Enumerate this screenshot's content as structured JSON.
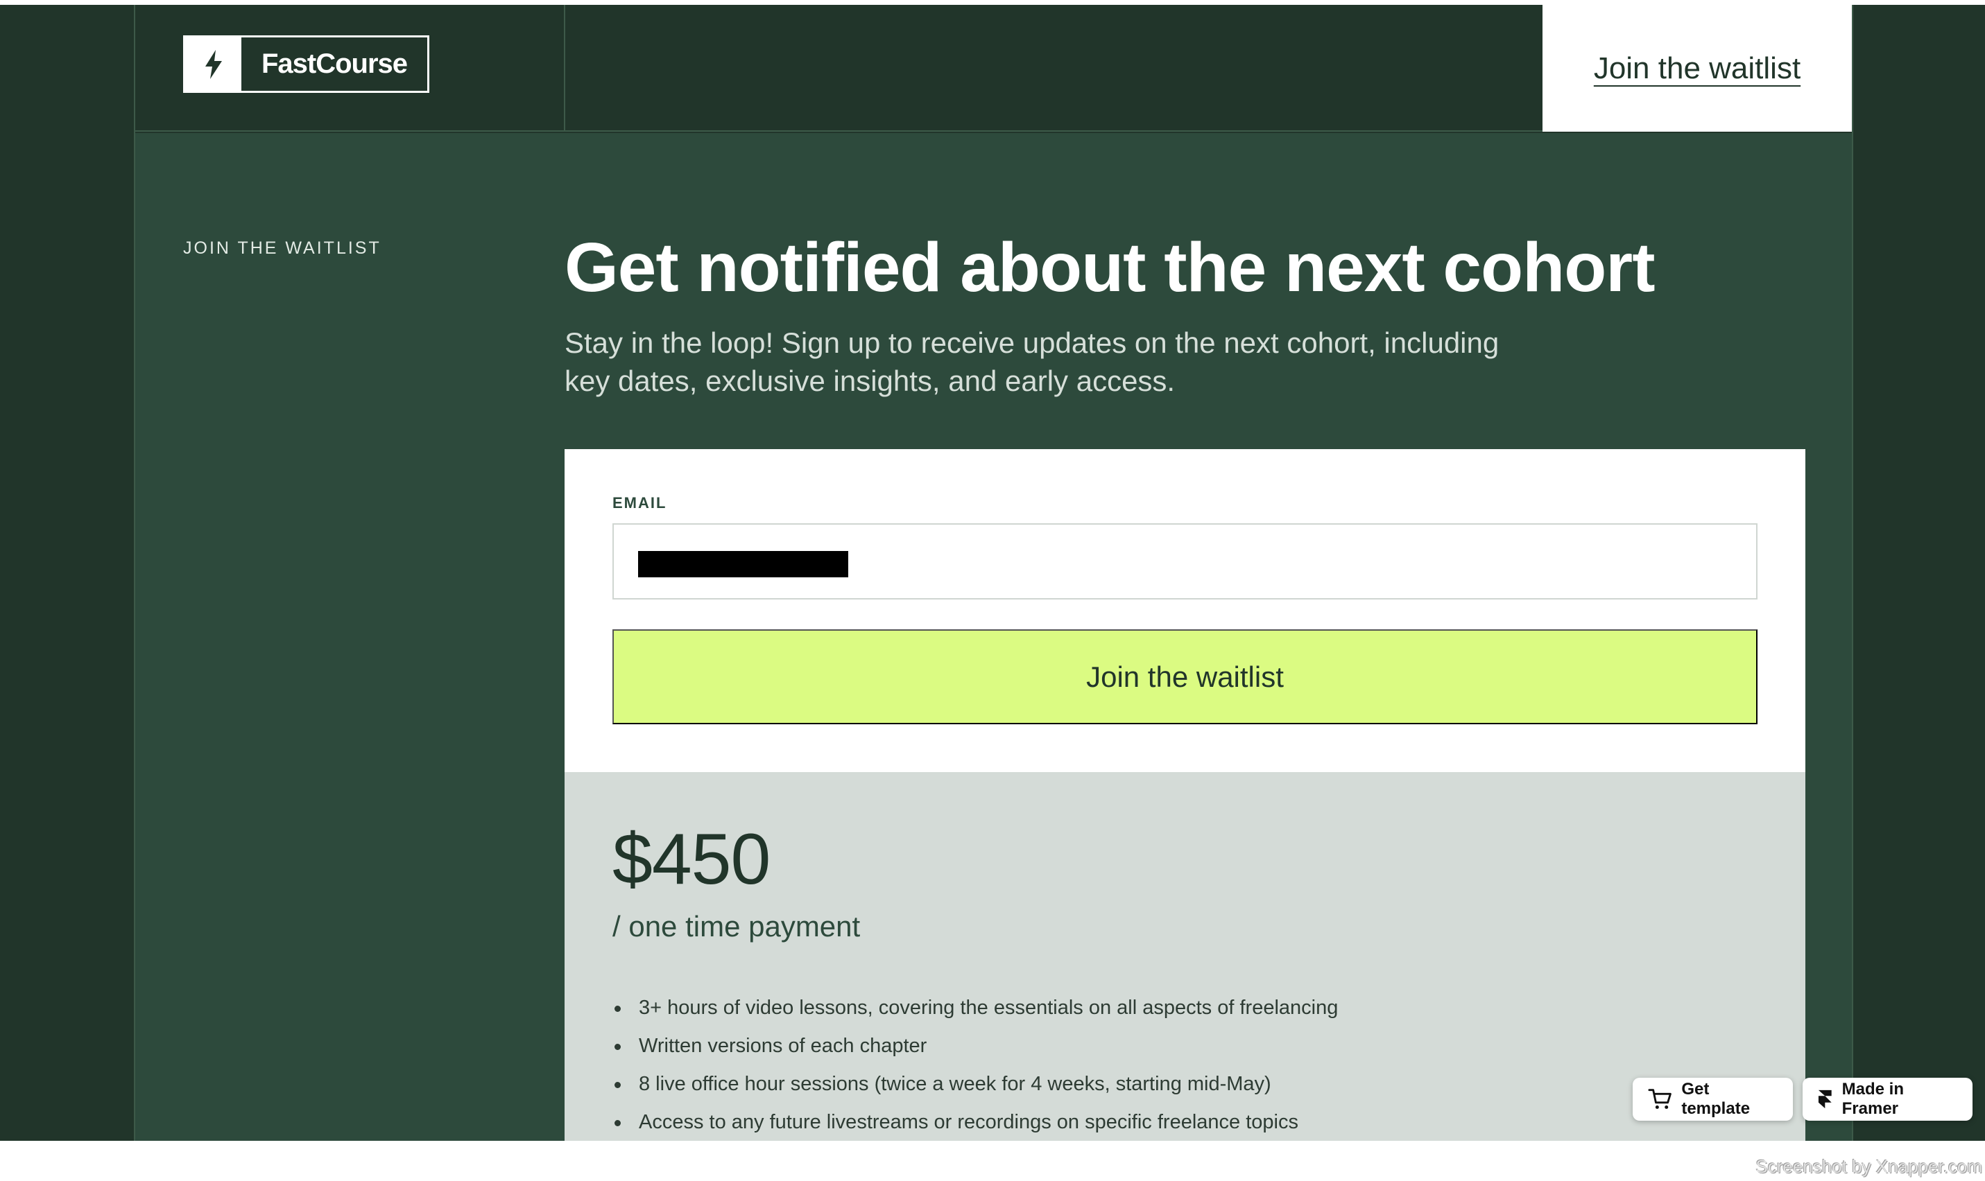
{
  "header": {
    "logo_text": "FastCourse",
    "nav_cta_label": "Join the waitlist"
  },
  "hero": {
    "eyebrow": "JOIN THE WAITLIST",
    "title": "Get notified about the next cohort",
    "subtitle": "Stay in the loop! Sign up to receive updates on the next cohort, including key dates, exclusive insights, and early access."
  },
  "form": {
    "email_label": "EMAIL",
    "submit_label": "Join the waitlist"
  },
  "pricing": {
    "price": "$450",
    "price_note": "/ one time payment",
    "features": [
      "3+ hours of video lessons, covering the essentials on all aspects of freelancing",
      "Written versions of each chapter",
      "8 live office hour sessions (twice a week for 4 weeks, starting mid-May)",
      "Access to any future livestreams or recordings on specific freelance topics"
    ]
  },
  "badges": {
    "get_template": "Get template",
    "made_in_framer": "Made in Framer"
  },
  "watermark": "Screenshot by Xnapper.com",
  "colors": {
    "background": "#21352a",
    "main_bg": "#2d4a3c",
    "accent": "#dbfb82",
    "pricing_bg": "#d4dbd7"
  },
  "icons": {
    "logo": "lightning-bolt-icon",
    "template_badge": "cart-icon",
    "framer_badge": "framer-icon"
  }
}
